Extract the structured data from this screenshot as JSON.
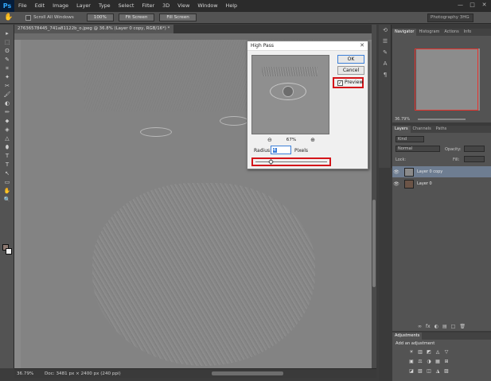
{
  "app": {
    "logo": "Ps"
  },
  "menu": [
    "File",
    "Edit",
    "Image",
    "Layer",
    "Type",
    "Select",
    "Filter",
    "3D",
    "View",
    "Window",
    "Help"
  ],
  "window_controls": [
    "—",
    "□",
    "✕"
  ],
  "options": {
    "scroll_all_windows": "Scroll All Windows",
    "btn_100": "100%",
    "btn_fit": "Fit Screen",
    "btn_fill": "Fill Screen",
    "workspace": "Photography 3HG"
  },
  "document": {
    "tab_title": "27636578445_741a81122b_o.jpeg @ 36.8% (Layer 0 copy, RGB/16*) *",
    "zoom": "36.79%",
    "info": "Doc: 3481 px × 2400 px (240 ppi)"
  },
  "tools": [
    "▸",
    "⬚",
    "ʘ",
    "✎",
    "⌗",
    "✦",
    "✂",
    "🖌",
    "◐",
    "✏",
    "⬥",
    "◈",
    "△",
    "⬮",
    "T",
    "↖",
    "▭",
    "✋",
    "🔍"
  ],
  "navigator": {
    "tabs": [
      "Navigator",
      "Histogram",
      "Actions",
      "Info"
    ],
    "zoom": "36.79%"
  },
  "layers": {
    "tabs": [
      "Layers",
      "Channels",
      "Paths"
    ],
    "kind": "Kind",
    "blend_mode": "Normal",
    "opacity_label": "Opacity:",
    "lock_label": "Lock:",
    "fill_label": "Fill:",
    "items": [
      {
        "name": "Layer 0 copy",
        "selected": true
      },
      {
        "name": "Layer 0",
        "selected": false
      }
    ],
    "footer_icons": [
      "fx",
      "◐",
      "▤",
      "□",
      "🗑"
    ]
  },
  "adjustments": {
    "tab": "Adjustments",
    "title": "Add an adjustment",
    "row1": [
      "☀",
      "▥",
      "◩",
      "◬",
      "▽"
    ],
    "row2": [
      "▣",
      "⚖",
      "◑",
      "▦",
      "⊞"
    ],
    "row3": [
      "◪",
      "▧",
      "◫",
      "◮",
      "▨"
    ]
  },
  "dialog": {
    "title": "High Pass",
    "close": "✕",
    "ok": "OK",
    "cancel": "Cancel",
    "preview_label": "Preview",
    "preview_checked": "✓",
    "zoom_out": "⊖",
    "zoom_in": "⊕",
    "zoom_level": "67%",
    "radius_label": "Radius:",
    "radius_value": "4",
    "radius_unit": "Pixels"
  },
  "colors": {
    "highlight": "#d4151a",
    "accent": "#3c7fd8",
    "foreground": "#8e7a72",
    "background": "#f2f2f2"
  }
}
